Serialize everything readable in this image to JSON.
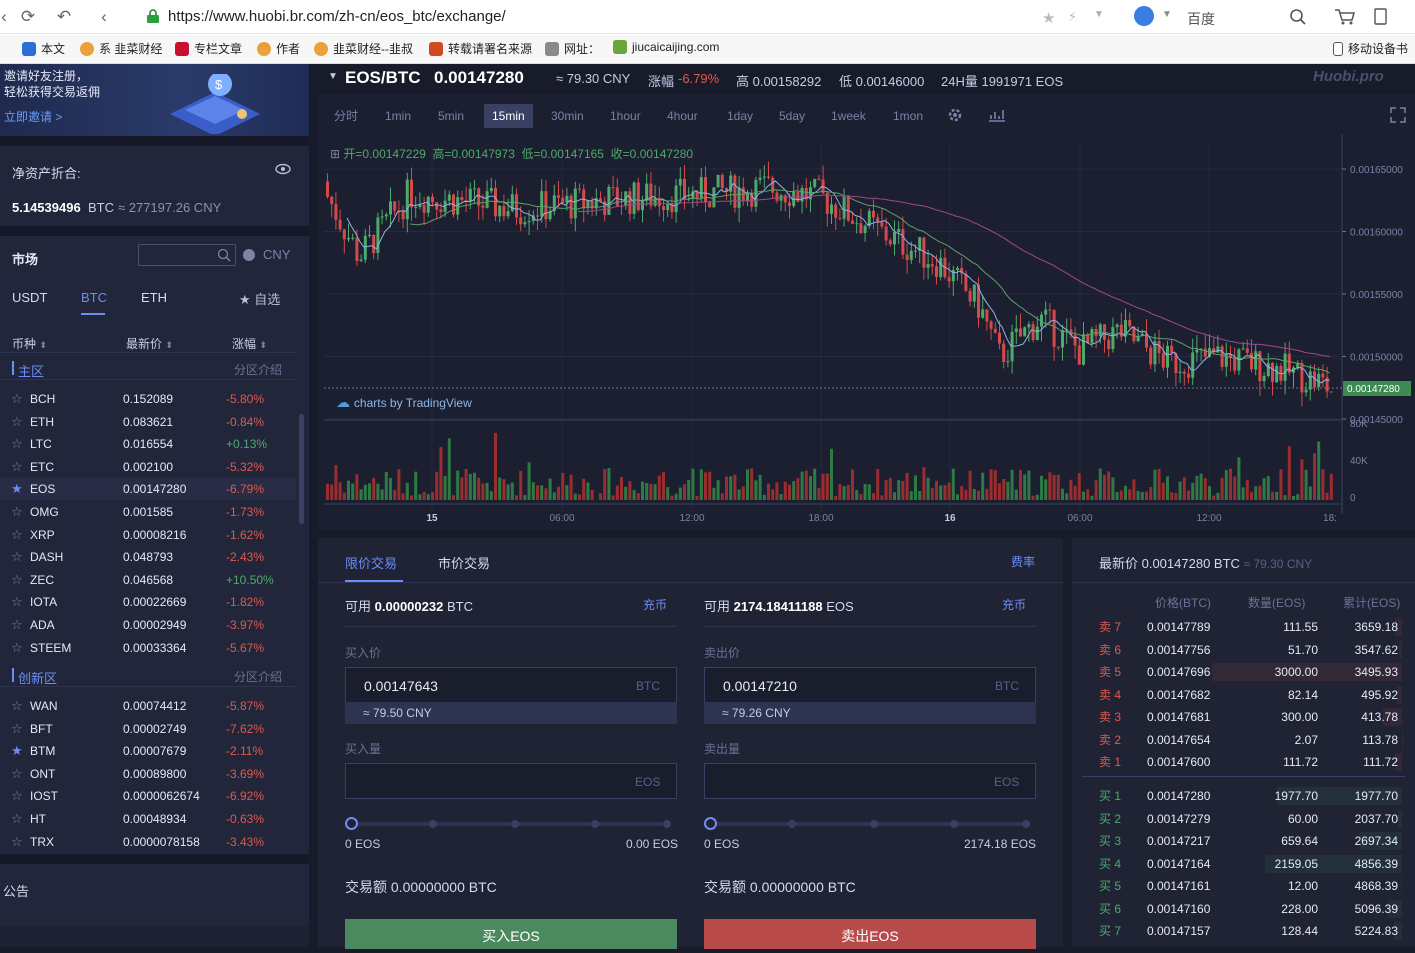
{
  "browser": {
    "url": "https://www.huobi.br.com/zh-cn/eos_btc/exchange/",
    "search_engine": "百度",
    "bookmarks": [
      "本文",
      "系 韭菜财经",
      "专栏文章",
      "作者",
      "韭菜财经--韭叔",
      "转载请署名来源",
      "网址：",
      "jiucaicaijing.com",
      "移动设备书"
    ]
  },
  "sidebar": {
    "banner_line1": "邀请好友注册，",
    "banner_line2": "轻松获得交易返佣",
    "banner_link": "立即邀请 >",
    "net_assets_label": "净资产折合:",
    "net_assets_btc": "5.14539496",
    "net_assets_unit": "BTC",
    "net_assets_cny": "≈ 277197.26 CNY",
    "market_label": "市场",
    "currency": "CNY",
    "tabs": [
      "USDT",
      "BTC",
      "ETH",
      "自选"
    ],
    "col_coin": "币种",
    "col_price": "最新价",
    "col_change": "涨幅",
    "zone_main": "主区",
    "zone_main_intro": "分区介绍",
    "zone_innov": "创新区",
    "zone_innov_intro": "分区介绍",
    "main_rows": [
      {
        "coin": "BCH",
        "price": "0.152089",
        "change": "-5.80%",
        "fav": false
      },
      {
        "coin": "ETH",
        "price": "0.083621",
        "change": "-0.84%",
        "fav": false
      },
      {
        "coin": "LTC",
        "price": "0.016554",
        "change": "+0.13%",
        "fav": false
      },
      {
        "coin": "ETC",
        "price": "0.002100",
        "change": "-5.32%",
        "fav": false
      },
      {
        "coin": "EOS",
        "price": "0.00147280",
        "change": "-6.79%",
        "fav": true
      },
      {
        "coin": "OMG",
        "price": "0.001585",
        "change": "-1.73%",
        "fav": false
      },
      {
        "coin": "XRP",
        "price": "0.00008216",
        "change": "-1.62%",
        "fav": false
      },
      {
        "coin": "DASH",
        "price": "0.048793",
        "change": "-2.43%",
        "fav": false
      },
      {
        "coin": "ZEC",
        "price": "0.046568",
        "change": "+10.50%",
        "fav": false
      },
      {
        "coin": "IOTA",
        "price": "0.00022669",
        "change": "-1.82%",
        "fav": false
      },
      {
        "coin": "ADA",
        "price": "0.00002949",
        "change": "-3.97%",
        "fav": false
      },
      {
        "coin": "STEEM",
        "price": "0.00033364",
        "change": "-5.67%",
        "fav": false
      }
    ],
    "innov_rows": [
      {
        "coin": "WAN",
        "price": "0.00074412",
        "change": "-5.87%",
        "fav": false
      },
      {
        "coin": "BFT",
        "price": "0.00002749",
        "change": "-7.62%",
        "fav": false
      },
      {
        "coin": "BTM",
        "price": "0.00007679",
        "change": "-2.11%",
        "fav": true
      },
      {
        "coin": "ONT",
        "price": "0.00089800",
        "change": "-3.69%",
        "fav": false
      },
      {
        "coin": "IOST",
        "price": "0.0000062674",
        "change": "-6.92%",
        "fav": false
      },
      {
        "coin": "HT",
        "price": "0.00048934",
        "change": "-0.63%",
        "fav": false
      },
      {
        "coin": "TRX",
        "price": "0.0000078158",
        "change": "-3.43%",
        "fav": false
      }
    ],
    "notice": "公告"
  },
  "ticker": {
    "pair": "EOS/BTC",
    "price": "0.00147280",
    "cny": "≈ 79.30 CNY",
    "change_label": "涨幅",
    "change": "-6.79%",
    "high": "高 0.00158292",
    "low": "低 0.00146000",
    "vol": "24H量 1991971 EOS",
    "brand": "Huobi.pro"
  },
  "chart": {
    "timeframes": [
      "分时",
      "1min",
      "5min",
      "15min",
      "30min",
      "1hour",
      "4hour",
      "1day",
      "5day",
      "1week",
      "1mon"
    ],
    "active_tf": "15min",
    "ohlc_open": "开=0.00147229",
    "ohlc_high": "高=0.00147973",
    "ohlc_low": "低=0.00147165",
    "ohlc_close": "收=0.00147280",
    "tradingview": "charts by TradingView",
    "y_ticks": [
      "0.00165000",
      "0.00160000",
      "0.00155000",
      "0.00150000",
      "0.00145000"
    ],
    "last_price_tag": "0.00147280",
    "vol_ticks": [
      "80K",
      "40K",
      "0"
    ],
    "x_ticks": [
      "15",
      "06:00",
      "12:00",
      "18:00",
      "16",
      "06:00",
      "12:00",
      "18:"
    ]
  },
  "order": {
    "tab_limit": "限价交易",
    "tab_market": "市价交易",
    "fee": "费率",
    "buy": {
      "avail_label": "可用",
      "avail": "0.00000232",
      "avail_unit": "BTC",
      "deposit": "充币",
      "price_label": "买入价",
      "price": "0.00147643",
      "price_unit": "BTC",
      "price_cny": "≈ 79.50 CNY",
      "amount_label": "买入量",
      "amount_unit": "EOS",
      "min": "0 EOS",
      "max": "0.00 EOS",
      "total_label": "交易额",
      "total": "0.00000000 BTC",
      "button": "买入EOS"
    },
    "sell": {
      "avail_label": "可用",
      "avail": "2174.18411188",
      "avail_unit": "EOS",
      "deposit": "充币",
      "price_label": "卖出价",
      "price": "0.00147210",
      "price_unit": "BTC",
      "price_cny": "≈ 79.26 CNY",
      "amount_label": "卖出量",
      "amount_unit": "EOS",
      "min": "0 EOS",
      "max": "2174.18 EOS",
      "total_label": "交易额",
      "total": "0.00000000 BTC",
      "button": "卖出EOS"
    }
  },
  "book": {
    "title": "最新价 0.00147280 BTC",
    "title_cny": "≈ 79.30 CNY",
    "col_price": "价格(BTC)",
    "col_amount": "数量(EOS)",
    "col_total": "累计(EOS)",
    "asks": [
      {
        "label": "卖 7",
        "price": "0.00147789",
        "amount": "111.55",
        "total": "3659.18"
      },
      {
        "label": "卖 6",
        "price": "0.00147756",
        "amount": "51.70",
        "total": "3547.62"
      },
      {
        "label": "卖 5",
        "price": "0.00147696",
        "amount": "3000.00",
        "total": "3495.93"
      },
      {
        "label": "卖 4",
        "price": "0.00147682",
        "amount": "82.14",
        "total": "495.92"
      },
      {
        "label": "卖 3",
        "price": "0.00147681",
        "amount": "300.00",
        "total": "413.78"
      },
      {
        "label": "卖 2",
        "price": "0.00147654",
        "amount": "2.07",
        "total": "113.78"
      },
      {
        "label": "卖 1",
        "price": "0.00147600",
        "amount": "111.72",
        "total": "111.72"
      }
    ],
    "bids": [
      {
        "label": "买 1",
        "price": "0.00147280",
        "amount": "1977.70",
        "total": "1977.70"
      },
      {
        "label": "买 2",
        "price": "0.00147279",
        "amount": "60.00",
        "total": "2037.70"
      },
      {
        "label": "买 3",
        "price": "0.00147217",
        "amount": "659.64",
        "total": "2697.34"
      },
      {
        "label": "买 4",
        "price": "0.00147164",
        "amount": "2159.05",
        "total": "4856.39"
      },
      {
        "label": "买 5",
        "price": "0.00147161",
        "amount": "12.00",
        "total": "4868.39"
      },
      {
        "label": "买 6",
        "price": "0.00147160",
        "amount": "228.00",
        "total": "5096.39"
      },
      {
        "label": "买 7",
        "price": "0.00147157",
        "amount": "128.44",
        "total": "5224.83"
      }
    ]
  },
  "colors": {
    "up": "#4eaa6c",
    "down": "#e0594f",
    "accent": "#6d8cf5",
    "buy_btn": "#4b8a5e",
    "sell_btn": "#b84a4a"
  }
}
